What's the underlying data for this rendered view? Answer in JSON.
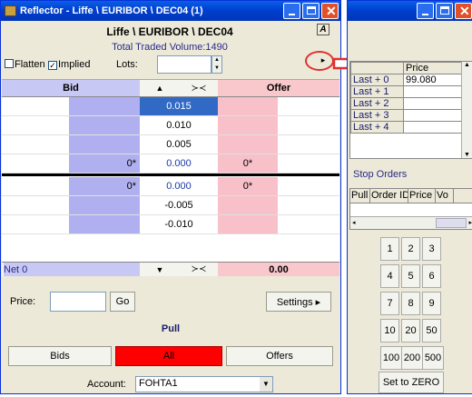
{
  "reflector": {
    "title": "Reflector - Liffe \\ EURIBOR \\ DEC04 (1)",
    "instrument": "Liffe \\ EURIBOR \\ DEC04",
    "volume": "Total Traded Volume:1490",
    "flatten": "Flatten",
    "implied": "Implied",
    "lots": "Lots:",
    "lots_value": "",
    "col_bid": "Bid",
    "col_offer": "Offer",
    "col_up": "▲",
    "col_center": "≻≺",
    "net": "Net 0",
    "net_value": "0.00",
    "net_down": "▼",
    "net_center": "≻≺",
    "price_label": "Price:",
    "price_value": "",
    "go": "Go",
    "settings": "Settings ▸",
    "pull": "Pull",
    "bids": "Bids",
    "all": "All",
    "offers": "Offers",
    "account_label": "Account:",
    "account_value": "FOHTA1"
  },
  "ladder_upper": [
    {
      "bid": "",
      "price": "0.015",
      "offer": ""
    },
    {
      "bid": "",
      "price": "0.010",
      "offer": ""
    },
    {
      "bid": "",
      "price": "0.005",
      "offer": ""
    },
    {
      "bid": "0*",
      "price": "0.000",
      "offer": "0*"
    }
  ],
  "ladder_lower": [
    {
      "bid": "0*",
      "price": "0.000",
      "offer": "0*"
    },
    {
      "bid": "",
      "price": "-0.005",
      "offer": ""
    },
    {
      "bid": "",
      "price": "-0.010",
      "offer": ""
    }
  ],
  "side": {
    "price_header": "Price",
    "last_rows": [
      {
        "label": "Last + 0",
        "price": "99.080"
      },
      {
        "label": "Last + 1",
        "price": ""
      },
      {
        "label": "Last + 2",
        "price": ""
      },
      {
        "label": "Last + 3",
        "price": ""
      },
      {
        "label": "Last + 4",
        "price": ""
      }
    ],
    "stop_orders": "Stop Orders",
    "stop_columns": [
      "Pull",
      "Order ID",
      "Price",
      "Vo"
    ],
    "keypad": [
      "1",
      "2",
      "3",
      "4",
      "5",
      "6",
      "7",
      "8",
      "9",
      "10",
      "20",
      "50",
      "100",
      "200",
      "500"
    ],
    "zero": "Set to ZERO"
  },
  "colors": {
    "title_bar": "#0a5fe6",
    "bid": "#b0b0f0",
    "offer": "#f8c0c8",
    "selected": "#316ac5",
    "all": "#ff0000",
    "annotation": "#e03030"
  }
}
